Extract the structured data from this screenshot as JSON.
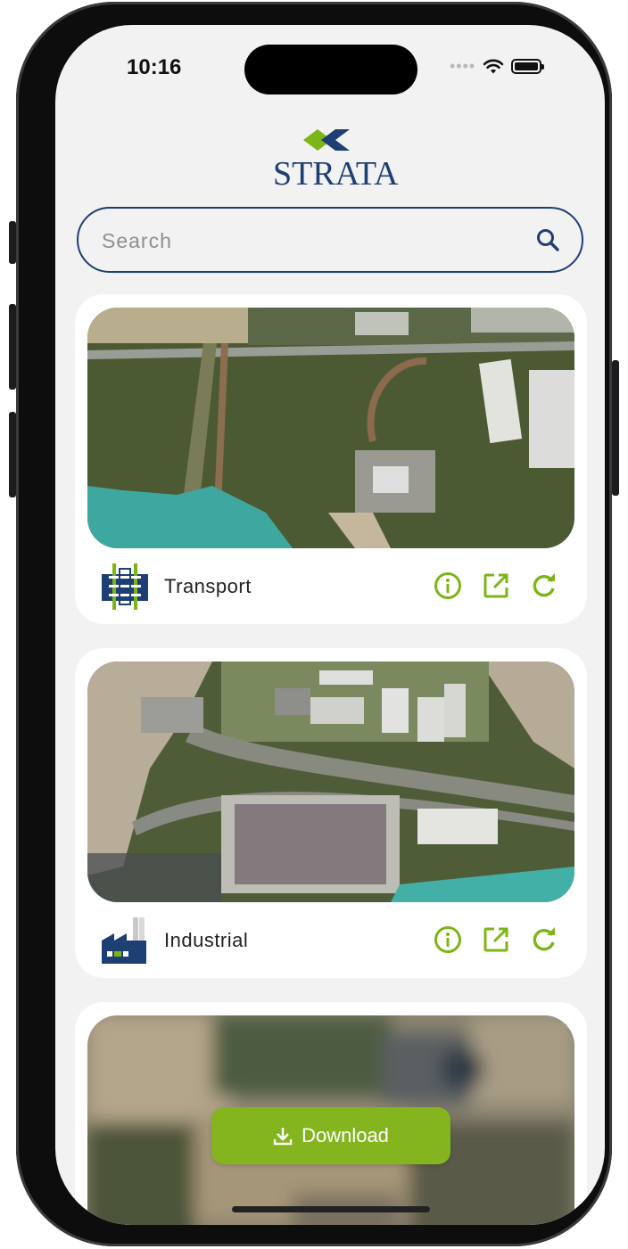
{
  "status_bar": {
    "time": "10:16"
  },
  "app": {
    "brand_name": "STRATA"
  },
  "search": {
    "placeholder": "Search",
    "value": ""
  },
  "cards": [
    {
      "label": "Transport",
      "icon": "railway-icon",
      "image": "aerial-forest-railway-render",
      "actions": [
        "info-icon",
        "open-external-icon",
        "refresh-icon"
      ]
    },
    {
      "label": "Industrial",
      "icon": "factory-icon",
      "image": "aerial-port-industrial-render",
      "actions": [
        "info-icon",
        "open-external-icon",
        "refresh-icon"
      ]
    },
    {
      "label": "",
      "image": "aerial-blurred-render",
      "download_label": "Download"
    }
  ],
  "colors": {
    "accent_green": "#84b51f",
    "brand_navy": "#1e3f73",
    "icon_green": "#7cb518",
    "background": "#f2f2f2",
    "card": "#ffffff"
  }
}
